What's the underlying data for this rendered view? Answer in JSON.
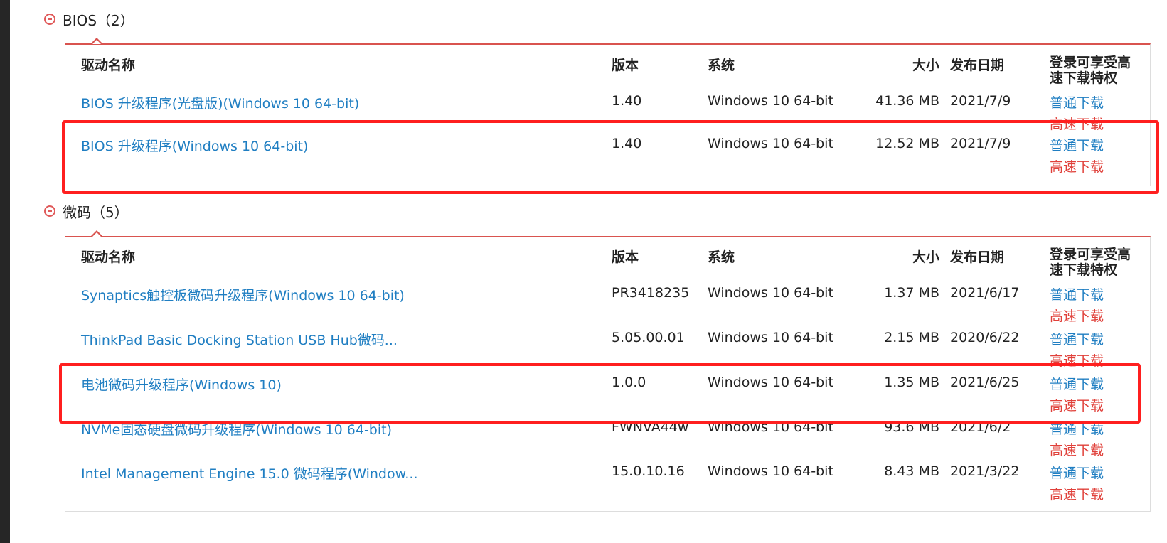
{
  "sections": [
    {
      "title": "BIOS（2）",
      "headers": {
        "name": "驱动名称",
        "version": "版本",
        "system": "系统",
        "size": "大小",
        "date": "发布日期",
        "download": "登录可享受高速下载特权"
      },
      "rows": [
        {
          "name": "BIOS 升级程序(光盘版)(Windows 10 64-bit)",
          "version": "1.40",
          "system": "Windows 10 64-bit",
          "size": "41.36 MB",
          "date": "2021/7/9",
          "normal": "普通下载",
          "fast": "高速下载"
        },
        {
          "name": "BIOS 升级程序(Windows 10 64-bit)",
          "version": "1.40",
          "system": "Windows 10 64-bit",
          "size": "12.52 MB",
          "date": "2021/7/9",
          "normal": "普通下载",
          "fast": "高速下载"
        }
      ]
    },
    {
      "title": "微码（5）",
      "headers": {
        "name": "驱动名称",
        "version": "版本",
        "system": "系统",
        "size": "大小",
        "date": "发布日期",
        "download": "登录可享受高速下载特权"
      },
      "rows": [
        {
          "name": "Synaptics触控板微码升级程序(Windows 10 64-bit)",
          "version": "PR3418235",
          "system": "Windows 10 64-bit",
          "size": "1.37 MB",
          "date": "2021/6/17",
          "normal": "普通下载",
          "fast": "高速下载"
        },
        {
          "name": "ThinkPad Basic Docking Station USB Hub微码...",
          "version": "5.05.00.01",
          "system": "Windows 10 64-bit",
          "size": "2.15 MB",
          "date": "2020/6/22",
          "normal": "普通下载",
          "fast": "高速下载"
        },
        {
          "name": "电池微码升级程序(Windows 10)",
          "version": "1.0.0",
          "system": "Windows 10 64-bit",
          "size": "1.35 MB",
          "date": "2021/6/25",
          "normal": "普通下载",
          "fast": "高速下载"
        },
        {
          "name": "NVMe固态硬盘微码升级程序(Windows 10 64-bit)",
          "version": "FWNVA44w",
          "system": "Windows 10 64-bit",
          "size": "93.6 MB",
          "date": "2021/6/2",
          "normal": "普通下载",
          "fast": "高速下载"
        },
        {
          "name": "Intel Management Engine 15.0 微码程序(Window...",
          "version": "15.0.10.16",
          "system": "Windows 10 64-bit",
          "size": "8.43 MB",
          "date": "2021/3/22",
          "normal": "普通下载",
          "fast": "高速下载"
        }
      ]
    }
  ],
  "colors": {
    "accent_red": "#d9534f",
    "link_blue": "#1f7ec2",
    "fast_red": "#e0403a",
    "highlight_red": "#ff1f1f"
  },
  "icons": {
    "section_toggle": "minus-circle-icon"
  }
}
